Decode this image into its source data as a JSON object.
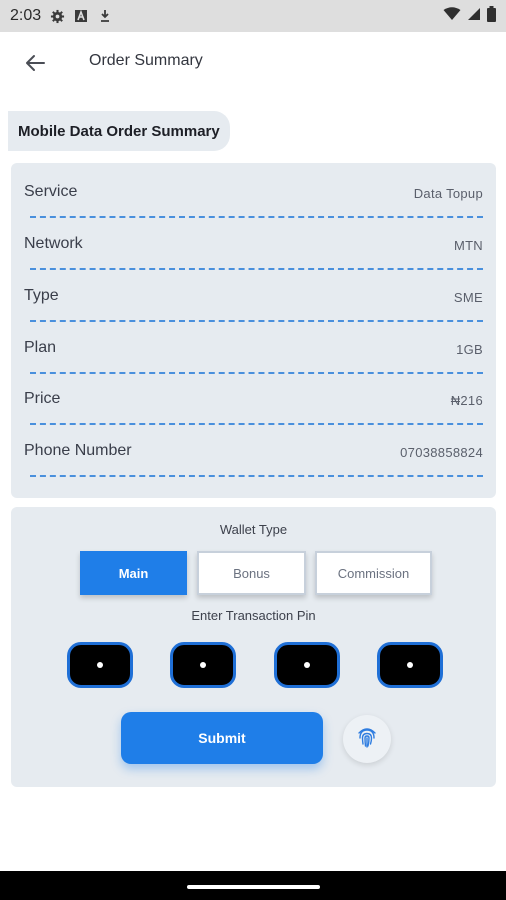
{
  "status_bar": {
    "time": "2:03",
    "icons": [
      "gear-icon",
      "a-badge-icon",
      "download-icon"
    ],
    "right_icons": [
      "wifi-icon",
      "signal-icon",
      "battery-icon"
    ]
  },
  "app_bar": {
    "back_icon": "arrow-left-icon",
    "title": "Order Summary"
  },
  "section_title": "Mobile Data Order Summary",
  "summary": [
    {
      "label": "Service",
      "value": "Data Topup"
    },
    {
      "label": "Network",
      "value": "MTN"
    },
    {
      "label": "Type",
      "value": "SME"
    },
    {
      "label": "Plan",
      "value": "1GB"
    },
    {
      "label": "Price",
      "value": "₦216"
    },
    {
      "label": "Phone Number",
      "value": "07038858824"
    }
  ],
  "wallet": {
    "label": "Wallet Type",
    "options": [
      {
        "label": "Main",
        "selected": true
      },
      {
        "label": "Bonus",
        "selected": false
      },
      {
        "label": "Commission",
        "selected": false
      }
    ]
  },
  "pin": {
    "label": "Enter Transaction Pin",
    "digits_filled": 4
  },
  "submit_label": "Submit",
  "biometric_icon": "fingerprint-icon",
  "colors": {
    "accent": "#1f7ee8",
    "card_bg": "#e6ebf0",
    "divider": "#4a90dd"
  }
}
